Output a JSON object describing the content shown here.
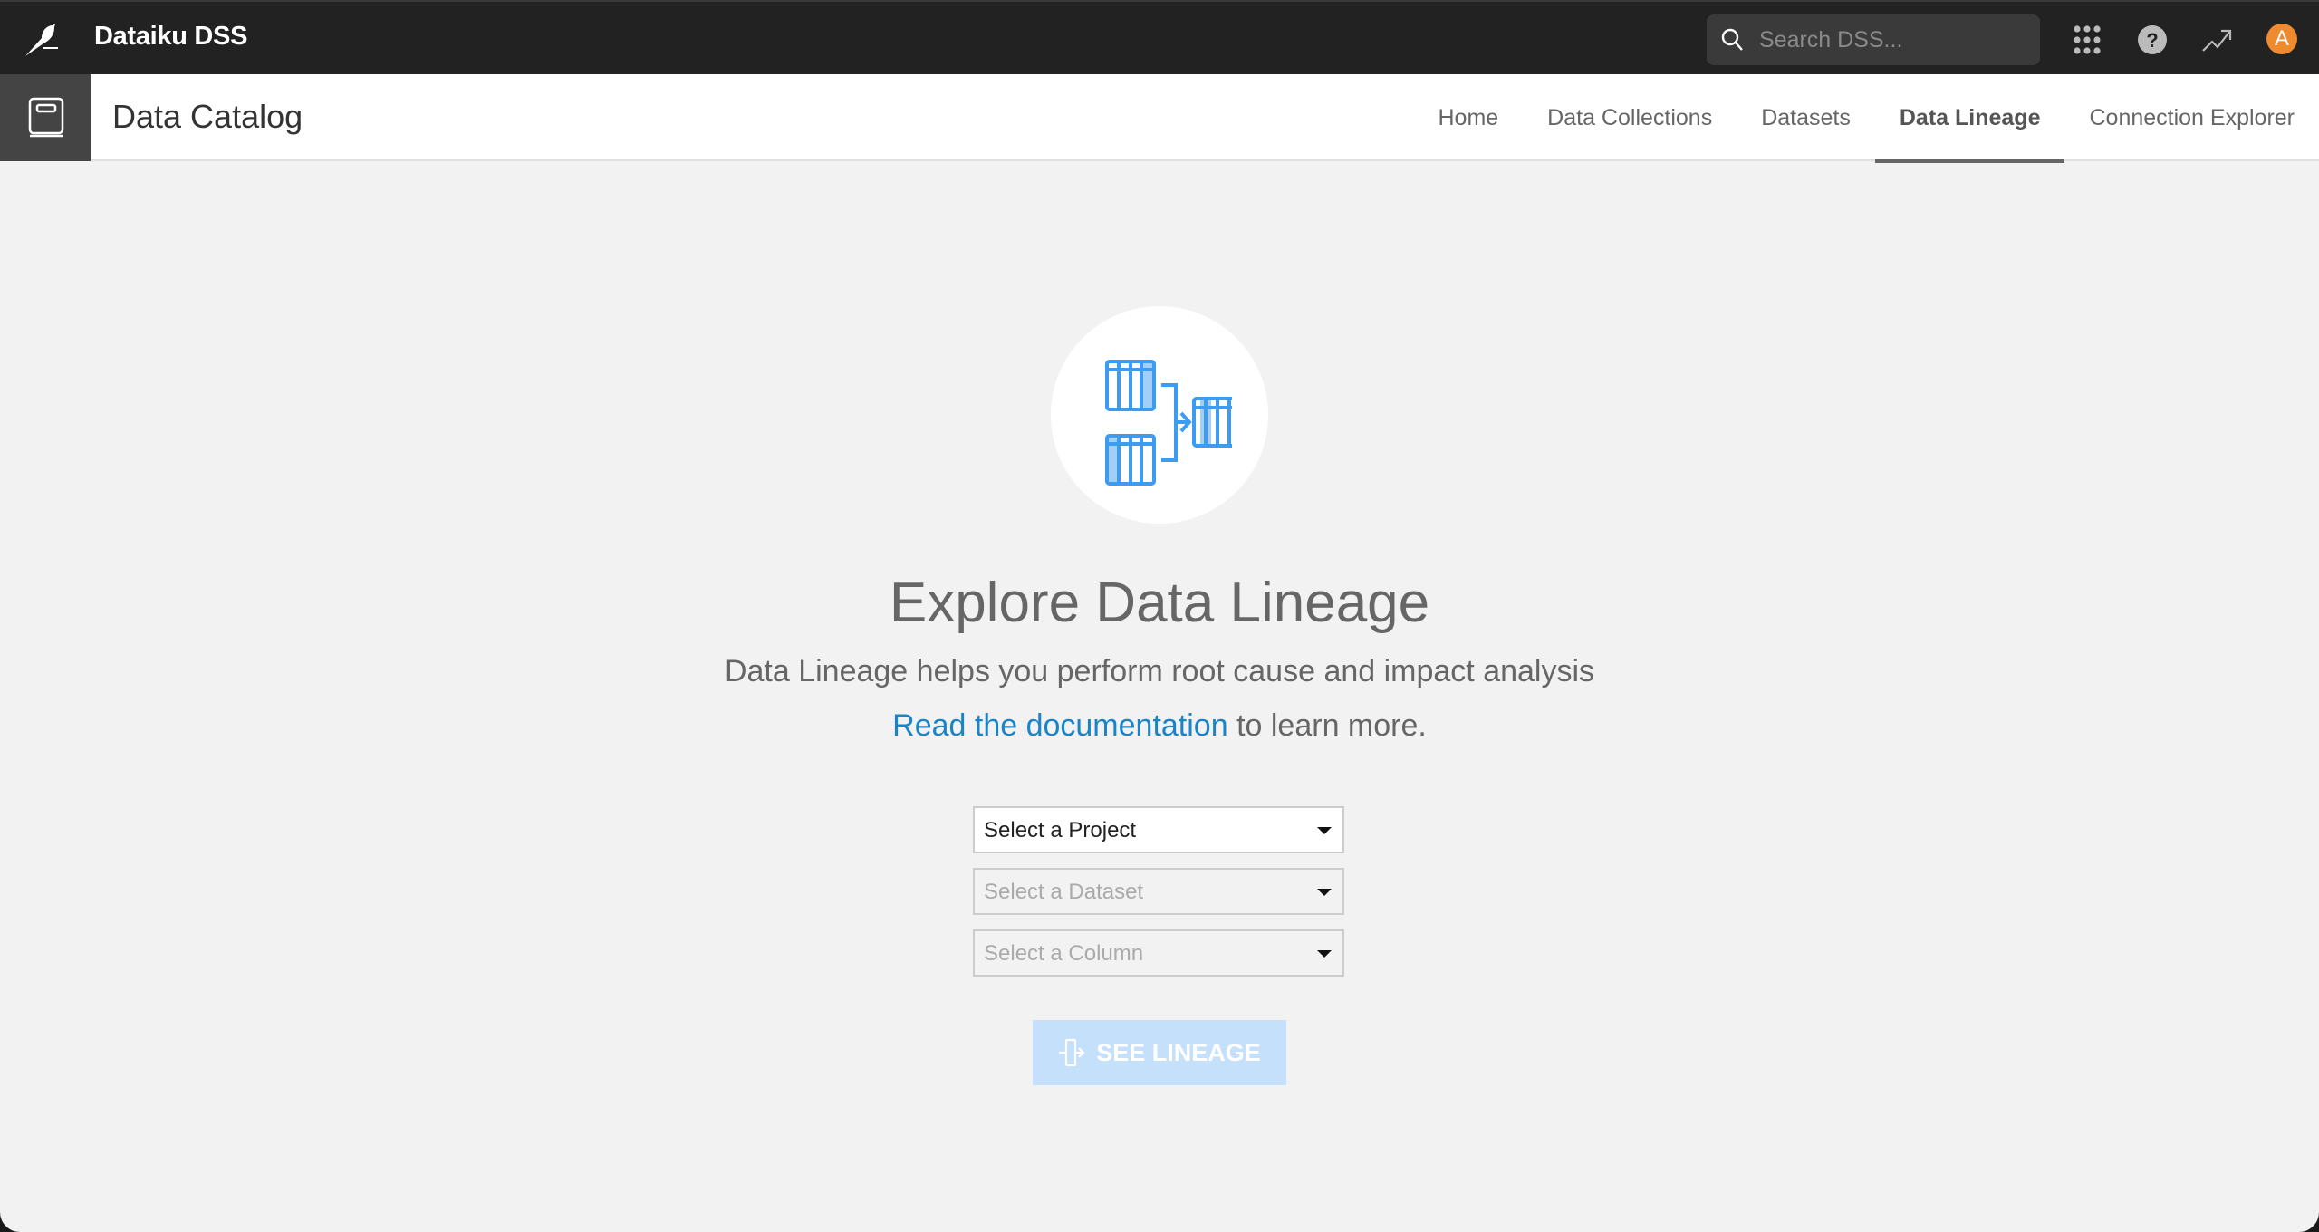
{
  "app": {
    "title": "Dataiku DSS",
    "search_placeholder": "Search DSS...",
    "avatar_initial": "A",
    "accent_color": "#f08a2e"
  },
  "subheader": {
    "title": "Data Catalog",
    "tabs": [
      {
        "label": "Home",
        "active": false
      },
      {
        "label": "Data Collections",
        "active": false
      },
      {
        "label": "Datasets",
        "active": false
      },
      {
        "label": "Data Lineage",
        "active": true
      },
      {
        "label": "Connection Explorer",
        "active": false
      }
    ]
  },
  "main": {
    "title": "Explore Data Lineage",
    "subtitle": "Data Lineage helps you perform root cause and impact analysis",
    "doc_link": "Read the documentation",
    "doc_suffix": " to learn more.",
    "selects": {
      "project": {
        "placeholder": "Select a Project",
        "enabled": true
      },
      "dataset": {
        "placeholder": "Select a Dataset",
        "enabled": false
      },
      "column": {
        "placeholder": "Select a Column",
        "enabled": false
      }
    },
    "see_lineage_label": "SEE LINEAGE",
    "link_color": "#1a84c7"
  }
}
